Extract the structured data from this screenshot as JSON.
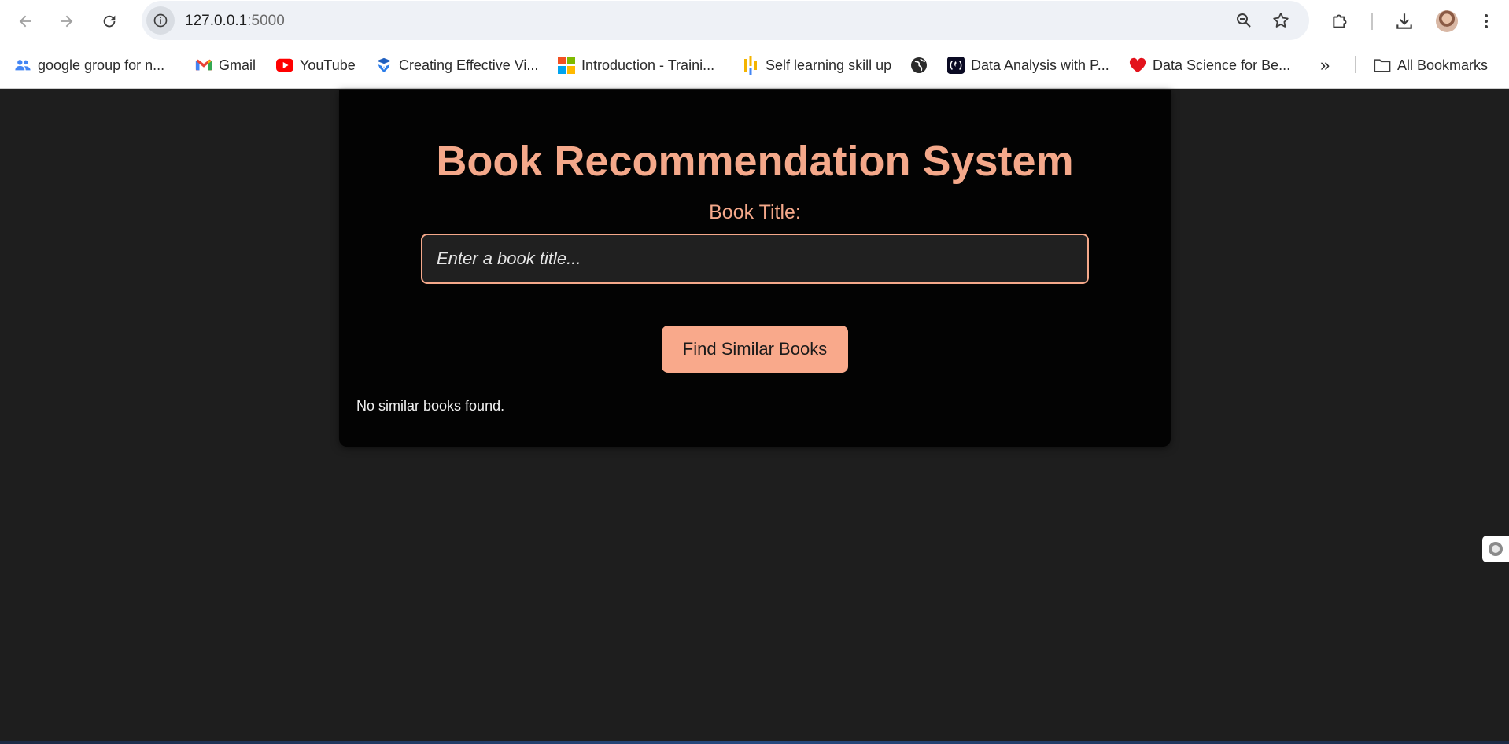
{
  "browser": {
    "url_host": "127.0.0.1",
    "url_port": ":5000",
    "bookmarks": [
      {
        "label": "google group for n...",
        "icon": "people-icon"
      },
      {
        "label": "Gmail",
        "icon": "gmail-icon"
      },
      {
        "label": "YouTube",
        "icon": "youtube-icon"
      },
      {
        "label": "Creating Effective Vi...",
        "icon": "layers-icon"
      },
      {
        "label": "Introduction - Traini...",
        "icon": "microsoft-icon"
      },
      {
        "label": "Self learning skill up",
        "icon": "bars-icon"
      },
      {
        "label": "",
        "icon": "globe-icon"
      },
      {
        "label": "Data Analysis with P...",
        "icon": "freecodecamp-icon"
      },
      {
        "label": "Data Science for Be...",
        "icon": "heart-icon"
      }
    ],
    "more_label": "»",
    "all_bookmarks_label": "All Bookmarks"
  },
  "main": {
    "title": "Book Recommendation System",
    "field_label": "Book Title:",
    "input_placeholder": "Enter a book title...",
    "input_value": "",
    "submit_label": "Find Similar Books",
    "result_text": "No similar books found."
  },
  "colors": {
    "accent": "#f4a88a",
    "button": "#f9a98b",
    "card": "#030303",
    "page_bg": "#1e1e1e"
  }
}
